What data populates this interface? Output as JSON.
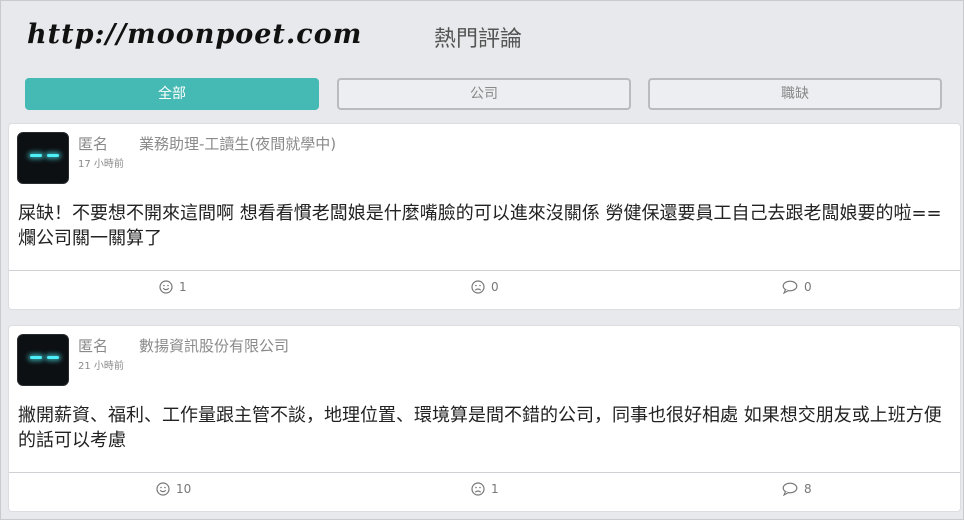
{
  "header": {
    "watermark": "http://moonpoet.com",
    "title": "熱門評論"
  },
  "tabs": [
    {
      "label": "全部",
      "active": true
    },
    {
      "label": "公司",
      "active": false
    },
    {
      "label": "職缺",
      "active": false
    }
  ],
  "colors": {
    "accent": "#45b9b3",
    "avatar_eye": "#4cf0f6"
  },
  "posts": [
    {
      "author": "匿名",
      "position": "業務助理-工讀生(夜間就學中)",
      "time": "17 小時前",
      "content": "屎缺！不要想不開來這間啊 想看看慣老闆娘是什麼嘴臉的可以進來沒關係 勞健保還要員工自己去跟老闆娘要的啦== 爛公司關一關算了",
      "likes": "1",
      "dislikes": "0",
      "comments": "0"
    },
    {
      "author": "匿名",
      "position": "數揚資訊股份有限公司",
      "time": "21 小時前",
      "content": "撇開薪資、福利、工作量跟主管不談，地理位置、環境算是間不錯的公司，同事也很好相處 如果想交朋友或上班方便的話可以考慮",
      "likes": "10",
      "dislikes": "1",
      "comments": "8"
    }
  ]
}
